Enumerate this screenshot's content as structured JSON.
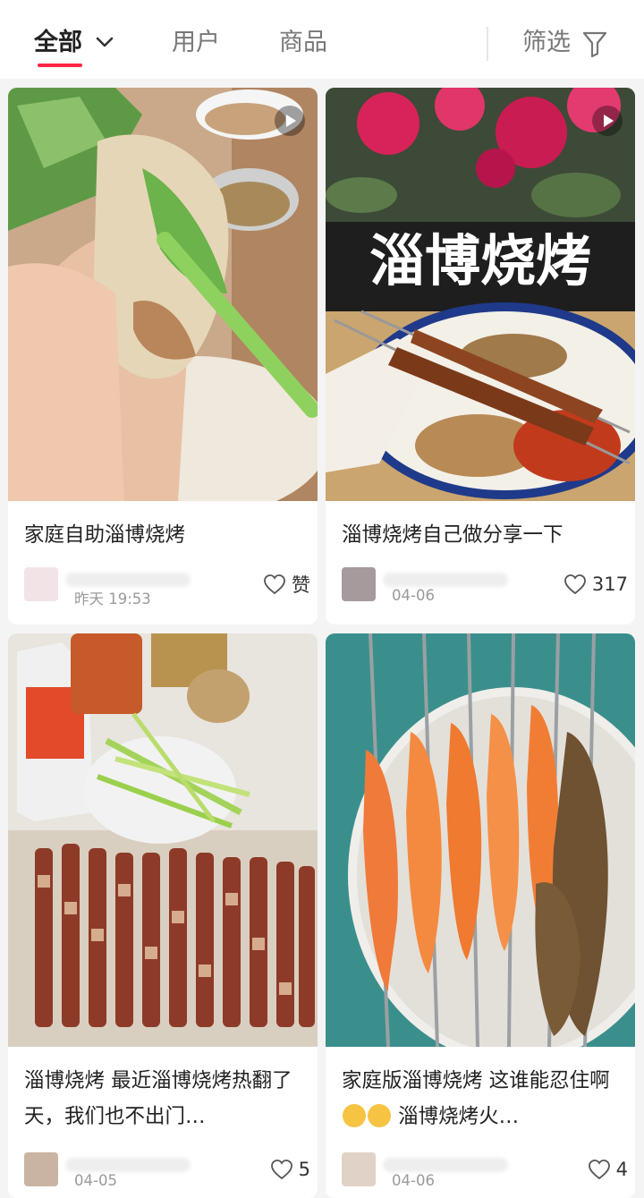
{
  "tabs": {
    "all": "全部",
    "users": "用户",
    "goods": "商品",
    "filter": "筛选"
  },
  "colors": {
    "accent": "#ff2442"
  },
  "cards": [
    {
      "title": "家庭自助淄博烧烤",
      "date": "昨天 19:53",
      "likes": "赞",
      "video": true,
      "image": "pancake wrap with lettuce and scallion"
    },
    {
      "title": "淄博烧烤自己做分享一下",
      "date": "04-06",
      "likes": "317",
      "video": true,
      "overlay_text": "淄博烧烤",
      "image": "pork skewers with chili powder and sesame on a plate"
    },
    {
      "title_part1": "淄博烧烤 最近淄博烧烤热翻了天，我们也不出门…",
      "date": "04-05",
      "likes": "5",
      "video": false,
      "image": "raw meat skewers, scallions and sauce bottle"
    },
    {
      "title_part1": "家庭版淄博烧烤 这谁能忍住啊",
      "title_part2": " 淄博烧烤火…",
      "date": "04-06",
      "likes": "4",
      "video": false,
      "image": "grilled shrimp and lamb skewers"
    }
  ]
}
